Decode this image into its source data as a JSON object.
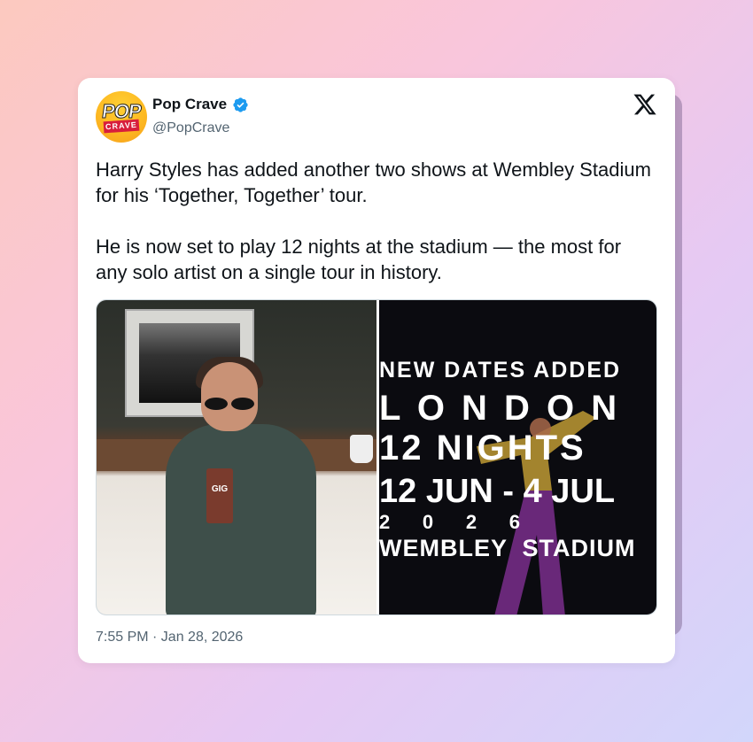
{
  "user": {
    "name": "Pop Crave",
    "handle": "@PopCrave",
    "avatar_top": "POP",
    "avatar_bottom": "CRAVE"
  },
  "tweet": {
    "text": "Harry Styles has added another two shows at Wembley Stadium for his ‘Together, Together’ tour.\n\nHe is now set to play 12 nights at the stadium — the most for any solo artist on a single tour in history.",
    "timestamp": "7:55 PM · Jan 28, 2026"
  },
  "media": {
    "poster_lines": [
      "NEW DATES ADDED",
      "L O N D O N",
      "12    NIGHTS",
      "12 JUN - 4 JUL",
      "2      0      2      6",
      "WEMBLEY  STADIUM"
    ],
    "cup_text": "GIG"
  },
  "colors": {
    "accent_verified": "#1d9bf0",
    "text_primary": "#0f1419",
    "text_secondary": "#536471"
  },
  "icons": {
    "verified": "verified-badge-icon",
    "x": "x-logo-icon"
  }
}
